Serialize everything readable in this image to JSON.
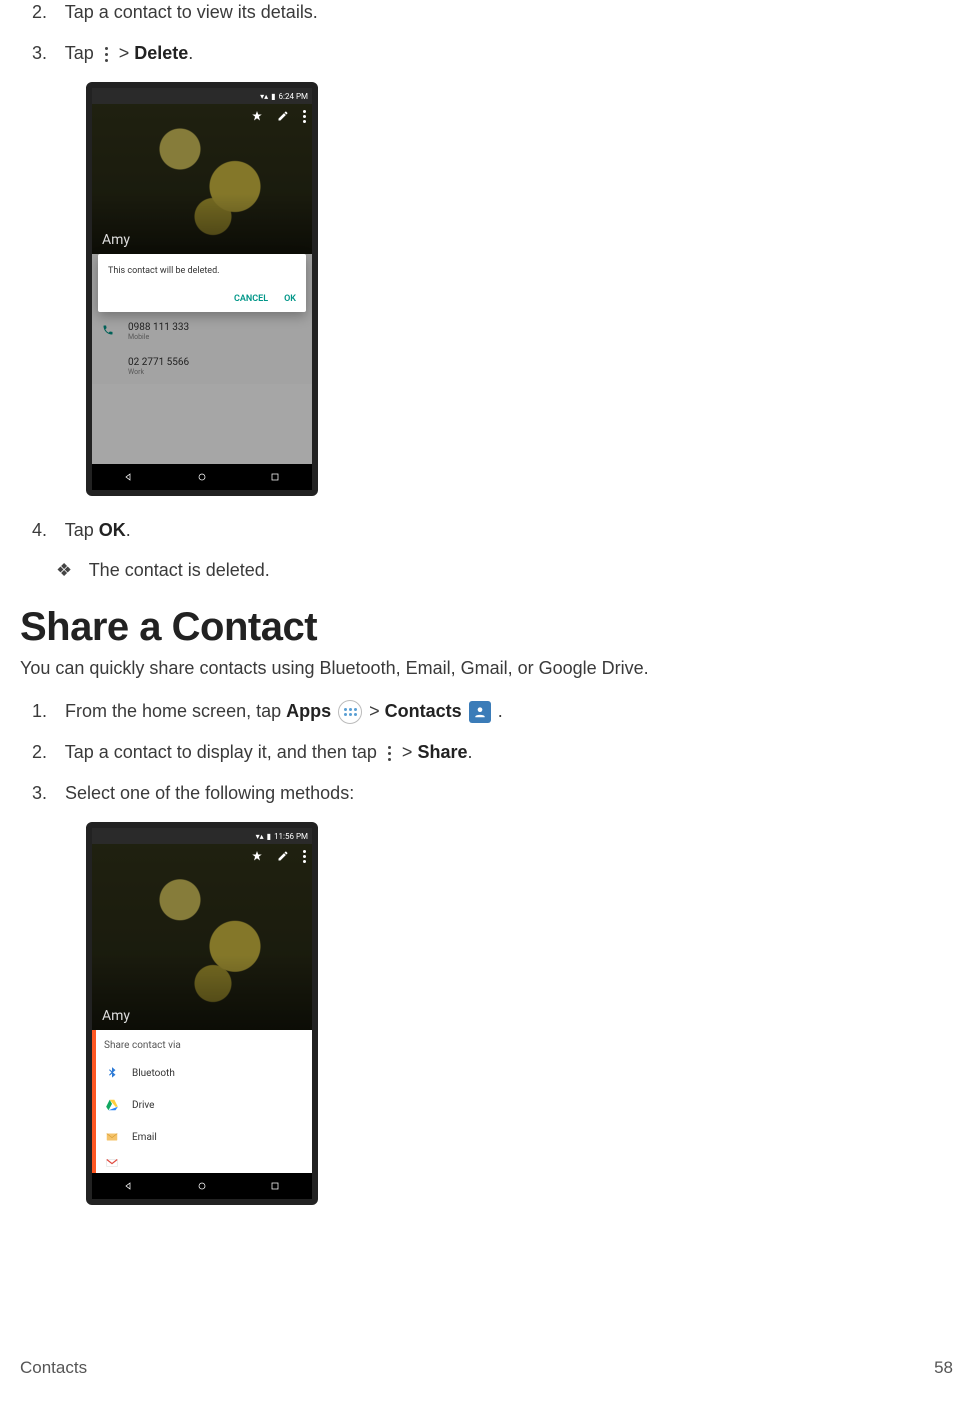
{
  "step2": {
    "num": "2.",
    "text": "Tap a contact to view its details."
  },
  "step3": {
    "num": "3.",
    "pre": "Tap ",
    "gt": " > ",
    "bold": "Delete",
    "post": "."
  },
  "step4": {
    "num": "4.",
    "pre": "Tap ",
    "bold": "OK",
    "post": "."
  },
  "result": {
    "bullet": "❖",
    "text": "The contact is deleted."
  },
  "heading": "Share a Contact",
  "intro": "You can quickly share contacts using Bluetooth, Email, Gmail, or Google Drive.",
  "share_step1": {
    "num": "1.",
    "pre": "From the home screen, tap ",
    "bold1": "Apps",
    "gt": " > ",
    "bold2": "Contacts",
    "post": " ."
  },
  "share_step2": {
    "num": "2.",
    "pre": "Tap a contact to display it, and then tap ",
    "gt": " > ",
    "bold": "Share",
    "post": "."
  },
  "share_step3": {
    "num": "3.",
    "text": "Select one of the following methods:"
  },
  "shot1": {
    "time": "6:24 PM",
    "name": "Amy",
    "dialog_msg": "This contact will be deleted.",
    "cancel": "CANCEL",
    "ok": "OK",
    "phone1": "0988 111 333",
    "phone1_label": "Mobile",
    "phone2": "02 2771 5566",
    "phone2_label": "Work"
  },
  "shot2": {
    "time": "11:56 PM",
    "name": "Amy",
    "title": "Share contact via",
    "opt1": "Bluetooth",
    "opt2": "Drive",
    "opt3": "Email"
  },
  "footer": {
    "section": "Contacts",
    "page": "58"
  }
}
